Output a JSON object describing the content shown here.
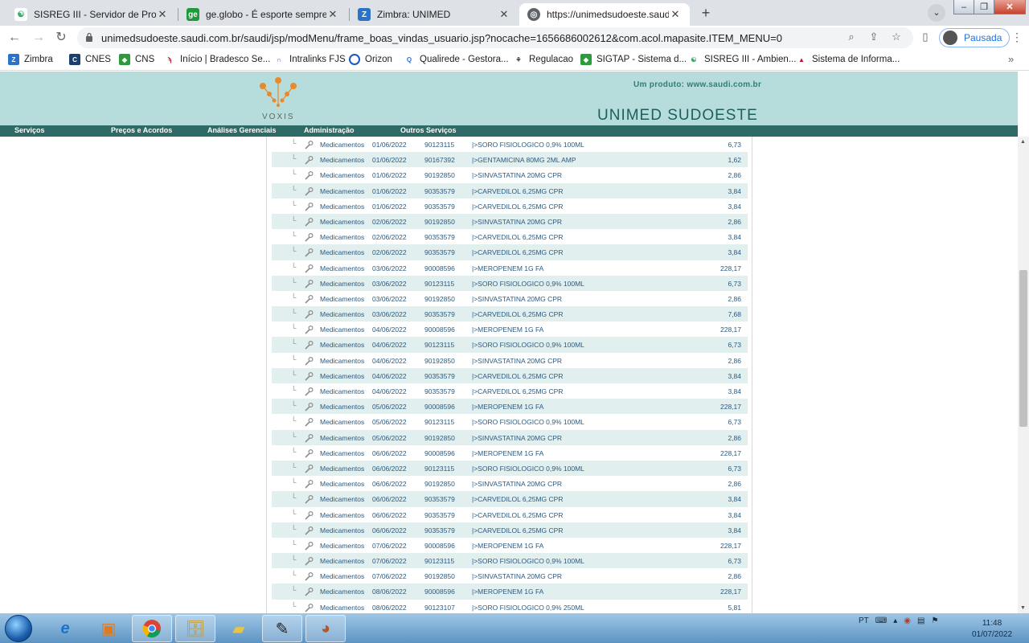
{
  "browser": {
    "tabs": [
      {
        "title": "SISREG III - Servidor de Producao",
        "favicon": "sisreg-icon"
      },
      {
        "title": "ge.globo - É esporte sempre",
        "favicon": "ge-icon"
      },
      {
        "title": "Zimbra: UNIMED",
        "favicon": "zimbra-icon"
      },
      {
        "title": "https://unimedsudoeste.saudi.com.br",
        "favicon": "globe-icon"
      }
    ],
    "url": "unimedsudoeste.saudi.com.br/saudi/jsp/modMenu/frame_boas_vindas_usuario.jsp?nocache=1656686002612&com.acol.mapasite.ITEM_MENU=0",
    "profile_label": "Pausada",
    "bookmarks": [
      "Zimbra",
      "CNES",
      "CNS",
      "Início | Bradesco Se...",
      "Intralinks FJS",
      "Orizon",
      "Qualirede - Gestora...",
      "Regulacao",
      "SIGTAP - Sistema d...",
      "SISREG III - Ambien...",
      "Sistema de Informa..."
    ]
  },
  "site": {
    "logo_text": "VOXIS",
    "tagline": "Um produto: www.saudi.com.br",
    "brand": "UNIMED SUDOESTE",
    "menu": [
      "Serviços",
      "Preços e Acordos",
      "Análises Gerenciais",
      "Administração",
      "Outros Serviços"
    ]
  },
  "items": [
    {
      "cat": "Medicamentos",
      "date": "01/06/2022",
      "code": "90123115",
      "desc": "|>SORO FISIOLOGICO 0,9% 100ML",
      "value": "6,73"
    },
    {
      "cat": "Medicamentos",
      "date": "01/06/2022",
      "code": "90167392",
      "desc": "|>GENTAMICINA 80MG 2ML AMP",
      "value": "1,62"
    },
    {
      "cat": "Medicamentos",
      "date": "01/06/2022",
      "code": "90192850",
      "desc": "|>SINVASTATINA 20MG CPR",
      "value": "2,86"
    },
    {
      "cat": "Medicamentos",
      "date": "01/06/2022",
      "code": "90353579",
      "desc": "|>CARVEDILOL 6,25MG CPR",
      "value": "3,84"
    },
    {
      "cat": "Medicamentos",
      "date": "01/06/2022",
      "code": "90353579",
      "desc": "|>CARVEDILOL 6,25MG CPR",
      "value": "3,84"
    },
    {
      "cat": "Medicamentos",
      "date": "02/06/2022",
      "code": "90192850",
      "desc": "|>SINVASTATINA 20MG CPR",
      "value": "2,86"
    },
    {
      "cat": "Medicamentos",
      "date": "02/06/2022",
      "code": "90353579",
      "desc": "|>CARVEDILOL 6,25MG CPR",
      "value": "3,84"
    },
    {
      "cat": "Medicamentos",
      "date": "02/06/2022",
      "code": "90353579",
      "desc": "|>CARVEDILOL 6,25MG CPR",
      "value": "3,84"
    },
    {
      "cat": "Medicamentos",
      "date": "03/06/2022",
      "code": "90008596",
      "desc": "|>MEROPENEM 1G FA",
      "value": "228,17"
    },
    {
      "cat": "Medicamentos",
      "date": "03/06/2022",
      "code": "90123115",
      "desc": "|>SORO FISIOLOGICO 0,9% 100ML",
      "value": "6,73"
    },
    {
      "cat": "Medicamentos",
      "date": "03/06/2022",
      "code": "90192850",
      "desc": "|>SINVASTATINA 20MG CPR",
      "value": "2,86"
    },
    {
      "cat": "Medicamentos",
      "date": "03/06/2022",
      "code": "90353579",
      "desc": "|>CARVEDILOL 6,25MG CPR",
      "value": "7,68"
    },
    {
      "cat": "Medicamentos",
      "date": "04/06/2022",
      "code": "90008596",
      "desc": "|>MEROPENEM 1G FA",
      "value": "228,17"
    },
    {
      "cat": "Medicamentos",
      "date": "04/06/2022",
      "code": "90123115",
      "desc": "|>SORO FISIOLOGICO 0,9% 100ML",
      "value": "6,73"
    },
    {
      "cat": "Medicamentos",
      "date": "04/06/2022",
      "code": "90192850",
      "desc": "|>SINVASTATINA 20MG CPR",
      "value": "2,86"
    },
    {
      "cat": "Medicamentos",
      "date": "04/06/2022",
      "code": "90353579",
      "desc": "|>CARVEDILOL 6,25MG CPR",
      "value": "3,84"
    },
    {
      "cat": "Medicamentos",
      "date": "04/06/2022",
      "code": "90353579",
      "desc": "|>CARVEDILOL 6,25MG CPR",
      "value": "3,84"
    },
    {
      "cat": "Medicamentos",
      "date": "05/06/2022",
      "code": "90008596",
      "desc": "|>MEROPENEM 1G FA",
      "value": "228,17"
    },
    {
      "cat": "Medicamentos",
      "date": "05/06/2022",
      "code": "90123115",
      "desc": "|>SORO FISIOLOGICO 0,9% 100ML",
      "value": "6,73"
    },
    {
      "cat": "Medicamentos",
      "date": "05/06/2022",
      "code": "90192850",
      "desc": "|>SINVASTATINA 20MG CPR",
      "value": "2,86"
    },
    {
      "cat": "Medicamentos",
      "date": "06/06/2022",
      "code": "90008596",
      "desc": "|>MEROPENEM 1G FA",
      "value": "228,17"
    },
    {
      "cat": "Medicamentos",
      "date": "06/06/2022",
      "code": "90123115",
      "desc": "|>SORO FISIOLOGICO 0,9% 100ML",
      "value": "6,73"
    },
    {
      "cat": "Medicamentos",
      "date": "06/06/2022",
      "code": "90192850",
      "desc": "|>SINVASTATINA 20MG CPR",
      "value": "2,86"
    },
    {
      "cat": "Medicamentos",
      "date": "06/06/2022",
      "code": "90353579",
      "desc": "|>CARVEDILOL 6,25MG CPR",
      "value": "3,84"
    },
    {
      "cat": "Medicamentos",
      "date": "06/06/2022",
      "code": "90353579",
      "desc": "|>CARVEDILOL 6,25MG CPR",
      "value": "3,84"
    },
    {
      "cat": "Medicamentos",
      "date": "06/06/2022",
      "code": "90353579",
      "desc": "|>CARVEDILOL 6,25MG CPR",
      "value": "3,84"
    },
    {
      "cat": "Medicamentos",
      "date": "07/06/2022",
      "code": "90008596",
      "desc": "|>MEROPENEM 1G FA",
      "value": "228,17"
    },
    {
      "cat": "Medicamentos",
      "date": "07/06/2022",
      "code": "90123115",
      "desc": "|>SORO FISIOLOGICO 0,9% 100ML",
      "value": "6,73"
    },
    {
      "cat": "Medicamentos",
      "date": "07/06/2022",
      "code": "90192850",
      "desc": "|>SINVASTATINA 20MG CPR",
      "value": "2,86"
    },
    {
      "cat": "Medicamentos",
      "date": "08/06/2022",
      "code": "90008596",
      "desc": "|>MEROPENEM 1G FA",
      "value": "228,17"
    },
    {
      "cat": "Medicamentos",
      "date": "08/06/2022",
      "code": "90123107",
      "desc": "|>SORO FISIOLOGICO 0,9% 250ML",
      "value": "5,81"
    }
  ],
  "taskbar": {
    "apps": [
      "internet-explorer-icon",
      "media-player-icon",
      "chrome-icon",
      "file-explorer-icon",
      "folder-icon",
      "syringe-app-icon",
      "paint-icon"
    ],
    "language": "PT",
    "time": "11:48",
    "date": "01/07/2022"
  },
  "colors": {
    "header_bg": "#b6dddb",
    "menubar_bg": "#2e6b66",
    "row_alt": "#e2efef",
    "row_text": "#2a5a80"
  }
}
